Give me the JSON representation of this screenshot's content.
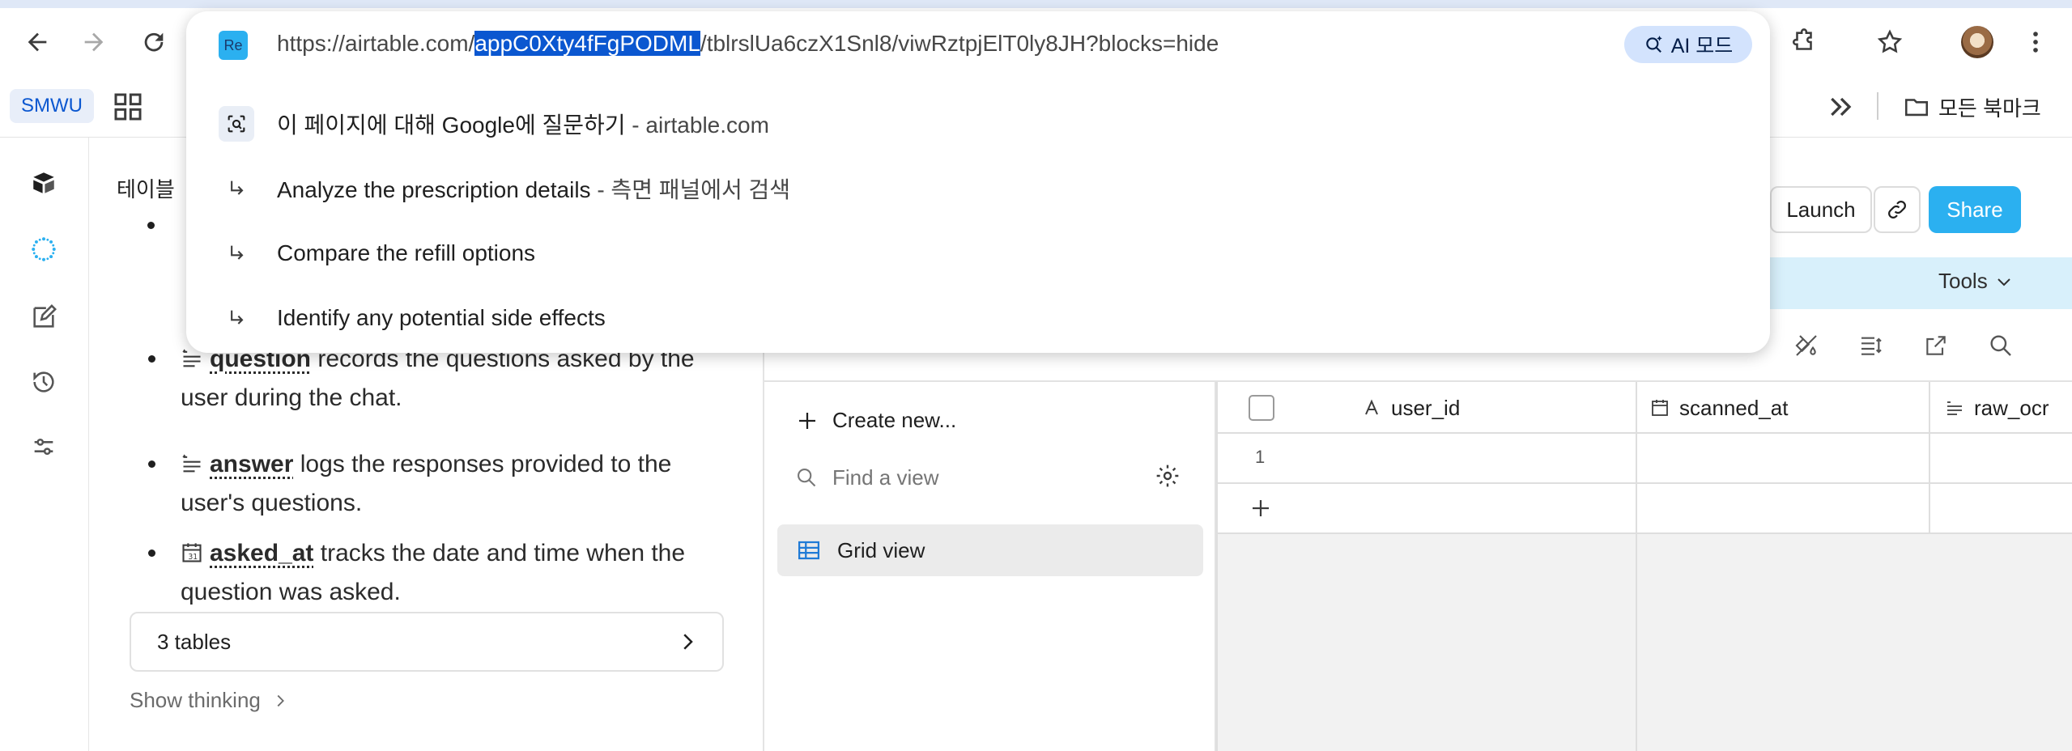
{
  "browser": {
    "url_prefix": "https://airtable.com/",
    "url_selected": "appC0Xty4fFgPODML",
    "url_suffix": "/tblrslUa6czX1Snl8/viwRztpjElT0ly8JH?blocks=hide",
    "site_badge": "Re",
    "ai_mode_label": "AI 모드",
    "bookmark_chip": "SMWU",
    "all_bookmarks": "모든 북마크",
    "suggestions": [
      {
        "main": "이 페이지에 대해 Google에 질문하기",
        "sub": " - airtable.com",
        "icon": "google-lens-icon"
      },
      {
        "main": "Analyze the prescription details",
        "sub": " - 측면 패널에서 검색",
        "icon": "subdirectory-arrow-icon"
      },
      {
        "main": "Compare the refill options",
        "sub": "",
        "icon": "subdirectory-arrow-icon"
      },
      {
        "main": "Identify any potential side effects",
        "sub": "",
        "icon": "subdirectory-arrow-icon"
      }
    ]
  },
  "chat": {
    "header_fragment": "테이블",
    "items": [
      {
        "field": "question",
        "text": " records the questions asked by the user during the chat.",
        "line1": " records the questions asked by the",
        "line2": "user during the chat."
      },
      {
        "field": "answer",
        "text": " logs the responses provided to the user's questions.",
        "line1": " logs the responses provided to the",
        "line2": "user's questions."
      },
      {
        "field": "asked_at",
        "text": " tracks the date and time when the question was asked.",
        "line1": " tracks the date and time when the",
        "line2": "question was asked."
      }
    ],
    "tables_card": "3 tables",
    "show_thinking": "Show thinking"
  },
  "airtable": {
    "launch_label": "Launch",
    "share_label": "Share",
    "tools_label": "Tools",
    "view_name_hidden": "Grid view",
    "create_new": "Create new...",
    "find_view_placeholder": "Find a view",
    "views": [
      {
        "label": "Grid view"
      }
    ],
    "columns": [
      {
        "label": "user_id",
        "icon": "text-field-icon"
      },
      {
        "label": "scanned_at",
        "icon": "calendar-icon"
      },
      {
        "label": "raw_ocr",
        "icon": "long-text-icon"
      }
    ],
    "rows": [
      {
        "number": "1"
      }
    ],
    "colors": {
      "accent": "#2bb0f0",
      "selection": "#0b57d0"
    }
  }
}
